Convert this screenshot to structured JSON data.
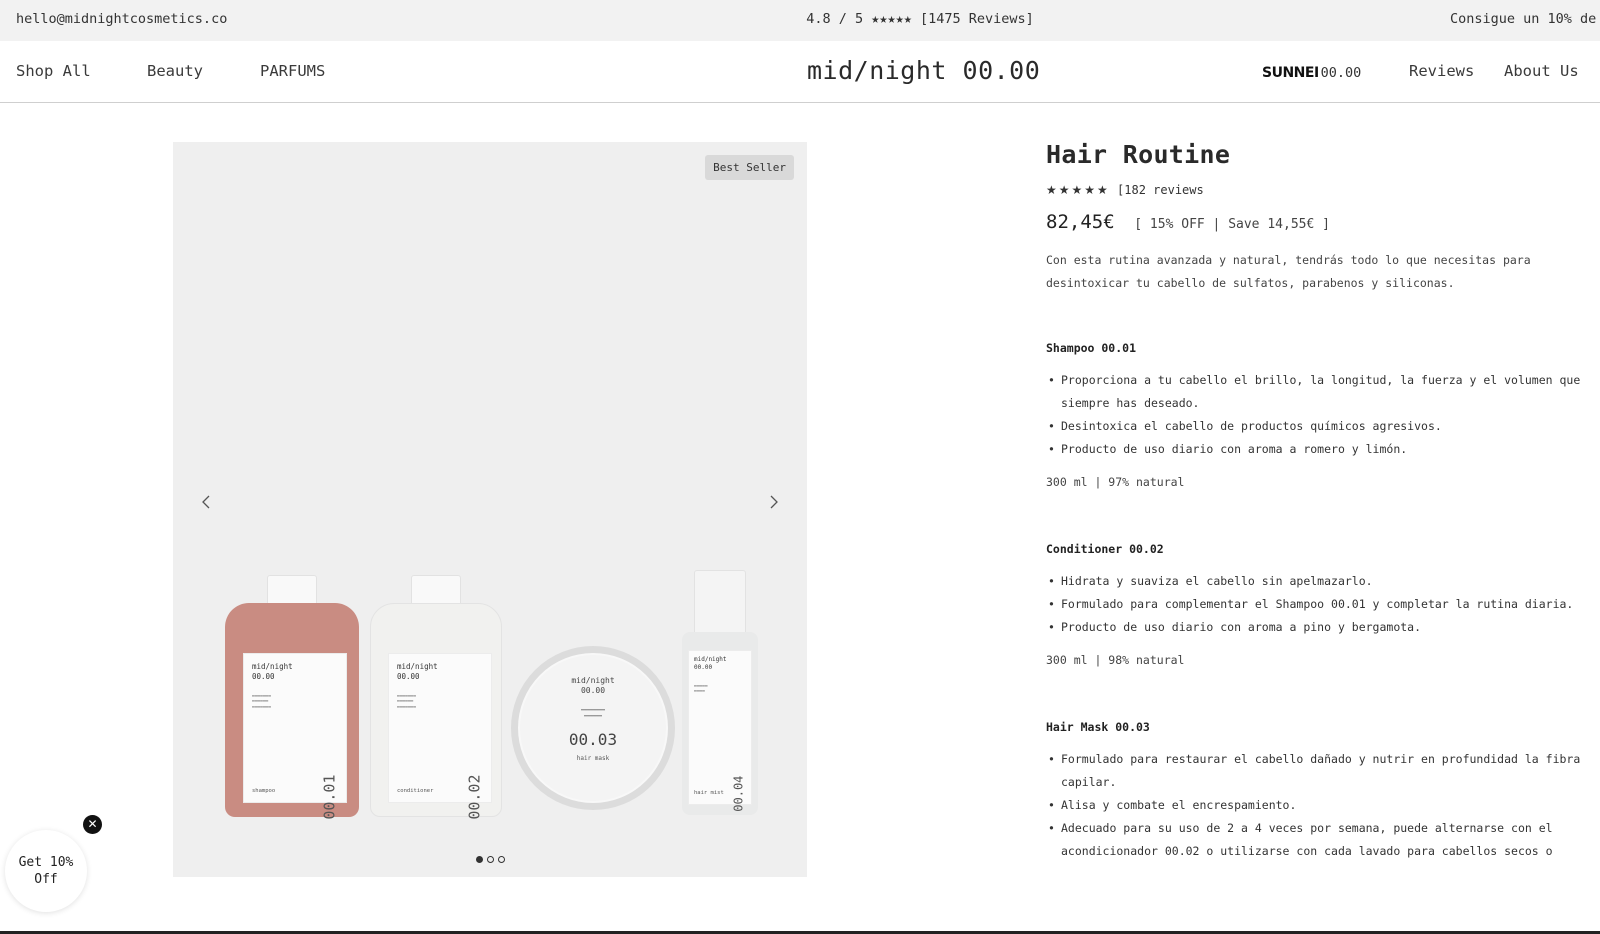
{
  "topbar": {
    "email": "hello@midnightcosmetics.co",
    "rating": "4.8 / 5 ★★★★★ [1475 Reviews]",
    "promo": "Consigue un 10% de"
  },
  "nav": {
    "shop_all": "Shop All",
    "beauty": "Beauty",
    "parfums": "PARFUMS",
    "logo": "mid/night 00.00",
    "sunnei_brand": "SUNNEI",
    "sunnei_code": "00.00",
    "reviews": "Reviews",
    "about_us": "About Us"
  },
  "gallery": {
    "badge": "Best Seller",
    "current_slide": 1,
    "total_slides": 3,
    "products": [
      {
        "brand": "mid/night",
        "code": "00.00",
        "number": "00.01",
        "kind": "shampoo",
        "color": "#c98c82"
      },
      {
        "brand": "mid/night",
        "code": "00.00",
        "number": "00.02",
        "kind": "conditioner",
        "color": "#f1f1ef"
      },
      {
        "brand": "mid/night",
        "code": "00.00",
        "number": "00.03",
        "kind": "hair mask",
        "color": "#f4f4f4"
      },
      {
        "brand": "mid/night",
        "code": "00.00",
        "number": "00.04",
        "kind": "hair mist",
        "color": "#e9eaea"
      }
    ]
  },
  "product": {
    "title": "Hair Routine",
    "stars": "★★★★★",
    "reviews": "[182 reviews",
    "price": "82,45€",
    "discount": "[ 15% OFF | Save 14,55€ ]",
    "description": "Con esta rutina avanzada y natural, tendrás todo lo que necesitas para desintoxicar tu cabello de sulfatos, parabenos y siliconas.",
    "sections": [
      {
        "heading": "Shampoo 00.01",
        "bullets": [
          "Proporciona a tu cabello el brillo, la longitud, la fuerza y el volumen que siempre has deseado.",
          "Desintoxica el cabello de productos químicos agresivos.",
          "Producto de uso diario con aroma a romero y limón."
        ],
        "spec": "300 ml | 97% natural"
      },
      {
        "heading": "Conditioner 00.02",
        "bullets": [
          "Hidrata y suaviza el cabello sin apelmazarlo.",
          "Formulado para complementar el Shampoo 00.01 y completar la rutina diaria.",
          "Producto de uso diario con aroma a pino y bergamota."
        ],
        "spec": "300 ml | 98% natural"
      },
      {
        "heading": "Hair Mask 00.03",
        "bullets": [
          "Formulado para restaurar el cabello dañado y nutrir en profundidad la fibra capilar.",
          "Alisa y combate el encrespamiento.",
          "Adecuado para su uso de 2 a 4 veces por semana, puede alternarse con el acondicionador 00.02 o utilizarse con cada lavado para cabellos secos o"
        ]
      }
    ]
  },
  "popup": {
    "line1": "Get 10%",
    "line2": "Off",
    "close": "✕"
  }
}
